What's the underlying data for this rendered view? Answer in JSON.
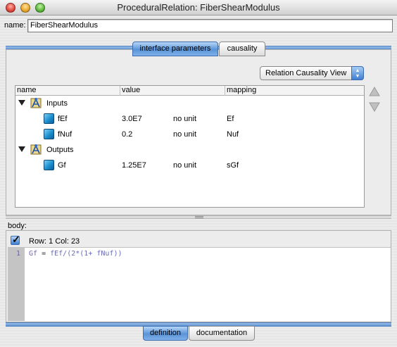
{
  "window": {
    "title": "ProceduralRelation: FiberShearModulus"
  },
  "name_field": {
    "label": "name:",
    "value": "FiberShearModulus"
  },
  "top_tabs": [
    {
      "label": "interface parameters",
      "active": true
    },
    {
      "label": "causality",
      "active": false
    }
  ],
  "view_select": {
    "value": "Relation Causality View"
  },
  "table": {
    "columns": [
      "name",
      "value",
      "mapping"
    ],
    "groups": [
      {
        "label": "Inputs",
        "rows": [
          {
            "name": "fEf",
            "value": "3.0E7",
            "unit": "no unit",
            "mapping": "Ef"
          },
          {
            "name": "fNuf",
            "value": "0.2",
            "unit": "no unit",
            "mapping": "Nuf"
          }
        ]
      },
      {
        "label": "Outputs",
        "rows": [
          {
            "name": "Gf",
            "value": "1.25E7",
            "unit": "no unit",
            "mapping": "sGf"
          }
        ]
      }
    ]
  },
  "body": {
    "label": "body:",
    "checkbox_checked": true,
    "row_label": "Row:",
    "row_value": "1",
    "col_label": "Col:",
    "col_value": "23",
    "line_number": "1",
    "code": {
      "t1": "Gf",
      "t2": " = ",
      "t3": "fEf",
      "t4": "/(",
      "t5": "2",
      "t6": "*(",
      "t7": "1",
      "t8": "+ ",
      "t9": "fNuf",
      "t10": "))"
    }
  },
  "bottom_tabs": [
    {
      "label": "definition",
      "active": true
    },
    {
      "label": "documentation",
      "active": false
    }
  ],
  "colors": {
    "accent": "#5a93d8",
    "cube": "#1b8fcf"
  }
}
